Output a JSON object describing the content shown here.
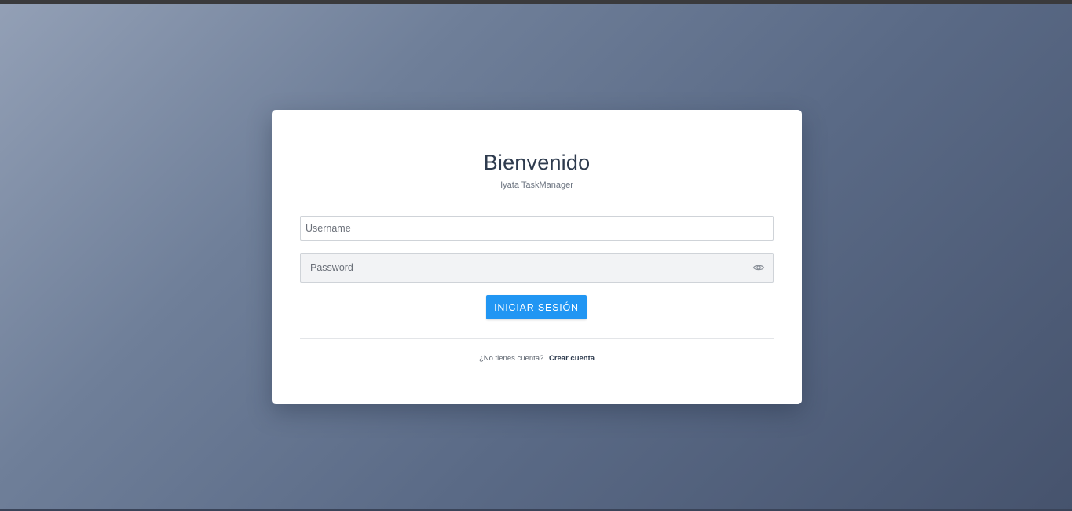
{
  "login": {
    "title": "Bienvenido",
    "subtitle": "Iyata TaskManager",
    "username_placeholder": "Username",
    "username_value": "",
    "password_placeholder": "Password",
    "password_value": "",
    "password_toggle_icon": "eye-icon",
    "submit_label": "INICIAR SESIÓN",
    "signup_prompt": "¿No tienes cuenta?",
    "signup_link": "Crear cuenta"
  },
  "colors": {
    "accent": "#2196f3",
    "title_text": "#2e3b4e",
    "background_start": "#93a0b6",
    "background_end": "#46536d"
  }
}
